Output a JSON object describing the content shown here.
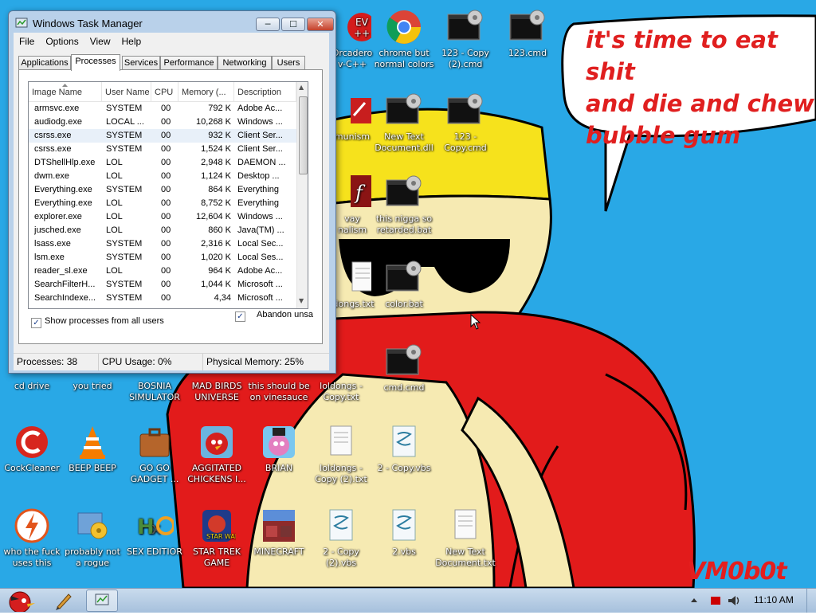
{
  "wallpaper": {
    "speech_lines": [
      "it's time to eat shit",
      "and die and chew",
      "bubble gum"
    ],
    "signature": "VM0b0t",
    "colors": {
      "sky": "#29a8e6",
      "shirt": "#e21b1b",
      "hat": "#f6e21c",
      "skin": "#f6eab2"
    }
  },
  "task_manager": {
    "title": "Windows Task Manager",
    "caption_buttons": {
      "minimize": "─",
      "maximize": "☐",
      "close": "✕"
    },
    "menu": [
      "File",
      "Options",
      "View",
      "Help"
    ],
    "tabs": [
      "Applications",
      "Processes",
      "Services",
      "Performance",
      "Networking",
      "Users"
    ],
    "active_tab": "Processes",
    "columns": [
      "Image Name",
      "User Name",
      "CPU",
      "Memory (...",
      "Description"
    ],
    "processes": [
      {
        "name": "armsvc.exe",
        "user": "SYSTEM",
        "cpu": "00",
        "mem": "792 K",
        "desc": "Adobe Ac..."
      },
      {
        "name": "audiodg.exe",
        "user": "LOCAL ...",
        "cpu": "00",
        "mem": "10,268 K",
        "desc": "Windows ..."
      },
      {
        "name": "csrss.exe",
        "user": "SYSTEM",
        "cpu": "00",
        "mem": "932 K",
        "desc": "Client Ser..."
      },
      {
        "name": "csrss.exe",
        "user": "SYSTEM",
        "cpu": "00",
        "mem": "1,524 K",
        "desc": "Client Ser..."
      },
      {
        "name": "DTShellHlp.exe",
        "user": "LOL",
        "cpu": "00",
        "mem": "2,948 K",
        "desc": "DAEMON ..."
      },
      {
        "name": "dwm.exe",
        "user": "LOL",
        "cpu": "00",
        "mem": "1,124 K",
        "desc": "Desktop ..."
      },
      {
        "name": "Everything.exe",
        "user": "SYSTEM",
        "cpu": "00",
        "mem": "864 K",
        "desc": "Everything"
      },
      {
        "name": "Everything.exe",
        "user": "LOL",
        "cpu": "00",
        "mem": "8,752 K",
        "desc": "Everything"
      },
      {
        "name": "explorer.exe",
        "user": "LOL",
        "cpu": "00",
        "mem": "12,604 K",
        "desc": "Windows ..."
      },
      {
        "name": "jusched.exe",
        "user": "LOL",
        "cpu": "00",
        "mem": "860 K",
        "desc": "Java(TM) ..."
      },
      {
        "name": "lsass.exe",
        "user": "SYSTEM",
        "cpu": "00",
        "mem": "2,316 K",
        "desc": "Local Sec..."
      },
      {
        "name": "lsm.exe",
        "user": "SYSTEM",
        "cpu": "00",
        "mem": "1,020 K",
        "desc": "Local Ses..."
      },
      {
        "name": "reader_sl.exe",
        "user": "LOL",
        "cpu": "00",
        "mem": "964 K",
        "desc": "Adobe Ac..."
      },
      {
        "name": "SearchFilterH...",
        "user": "SYSTEM",
        "cpu": "00",
        "mem": "1,044 K",
        "desc": "Microsoft ..."
      },
      {
        "name": "SearchIndexe...",
        "user": "SYSTEM",
        "cpu": "00",
        "mem": "4,34",
        "desc": "Microsoft ..."
      }
    ],
    "show_all_label": "Show processes from all users",
    "end_process_label": "Abandon unsa",
    "status": {
      "processes": "Processes: 38",
      "cpu": "CPU Usage: 0%",
      "memory": "Physical Memory: 25%"
    }
  },
  "desktop_icons": [
    {
      "id": "dev-cpp",
      "label": "Orcadero\nv-C++",
      "icon": "devcpp-icon"
    },
    {
      "id": "chrome",
      "label": "chrome but\nnormal colors",
      "icon": "chrome-icon"
    },
    {
      "id": "123-copy2",
      "label": "123 - Copy\n(2).cmd",
      "icon": "cmd-icon"
    },
    {
      "id": "123",
      "label": "123.cmd",
      "icon": "cmd-icon"
    },
    {
      "id": "communism",
      "label": "munism",
      "icon": "app-icon"
    },
    {
      "id": "newtext-dll",
      "label": "New Text\nDocument.dll",
      "icon": "cmd-icon"
    },
    {
      "id": "123-copy",
      "label": "123 -\nCopy.cmd",
      "icon": "cmd-icon"
    },
    {
      "id": "flash",
      "label": "vay\nnalism",
      "icon": "flash-icon"
    },
    {
      "id": "nigga-bat",
      "label": "this nigga so\nretarded.bat",
      "icon": "cmd-icon"
    },
    {
      "id": "loldongs",
      "label": "ldongs.txt",
      "icon": "text-icon"
    },
    {
      "id": "color-bat",
      "label": "color.bat",
      "icon": "cmd-icon"
    },
    {
      "id": "cmd-cmd",
      "label": "cmd.cmd",
      "icon": "cmd-icon"
    },
    {
      "id": "cd-drive",
      "label": "cd drive",
      "icon": "cd-icon"
    },
    {
      "id": "you-tried",
      "label": "you tried",
      "icon": "app-icon"
    },
    {
      "id": "bosnia",
      "label": "BOSNIA\nSIMULATOR",
      "icon": "app-icon"
    },
    {
      "id": "mad-birds",
      "label": "MAD BIRDS\nUNIVERSE",
      "icon": "app-icon"
    },
    {
      "id": "vinesauce",
      "label": "this should be\non vinesauce",
      "icon": "app-icon"
    },
    {
      "id": "loldongs-copy",
      "label": "loldongs -\nCopy.txt",
      "icon": "text-icon"
    },
    {
      "id": "ccleaner",
      "label": "CockCleaner",
      "icon": "ccleaner-icon"
    },
    {
      "id": "beep",
      "label": "BEEP BEEP",
      "icon": "vlc-icon"
    },
    {
      "id": "gogo",
      "label": "GO GO\nGADGET ...",
      "icon": "briefcase-icon"
    },
    {
      "id": "agg-chickens",
      "label": "AGGITATED\nCHICKENS I...",
      "icon": "angrybird-icon"
    },
    {
      "id": "brian",
      "label": "BRIAN",
      "icon": "pinkbird-icon"
    },
    {
      "id": "loldongs-copy2",
      "label": "loldongs -\nCopy (2).txt",
      "icon": "text-icon"
    },
    {
      "id": "2-copy-vbs",
      "label": "2 - Copy.vbs",
      "icon": "vbs-icon"
    },
    {
      "id": "who-the",
      "label": "who the fuck\nuses this",
      "icon": "flash-orange-icon"
    },
    {
      "id": "rogue",
      "label": "probably not\na rogue",
      "icon": "gears-icon"
    },
    {
      "id": "sex-editor",
      "label": "SEX EDITIOR",
      "icon": "hxd-icon"
    },
    {
      "id": "star-trek",
      "label": "STAR TREK\nGAME",
      "icon": "starwars-icon"
    },
    {
      "id": "minecraft",
      "label": "MINECRAFT",
      "icon": "minecraft-icon"
    },
    {
      "id": "2-copy2-vbs",
      "label": "2 - Copy\n(2).vbs",
      "icon": "vbs-icon"
    },
    {
      "id": "2-vbs",
      "label": "2.vbs",
      "icon": "vbs-icon"
    },
    {
      "id": "newtext-txt",
      "label": "New Text\nDocument.txt",
      "icon": "text-icon"
    }
  ],
  "taskbar": {
    "clock": "11:10 AM",
    "colors": {
      "bar_top": "#c9dbed",
      "bar_bottom": "#a6c0dc"
    }
  }
}
